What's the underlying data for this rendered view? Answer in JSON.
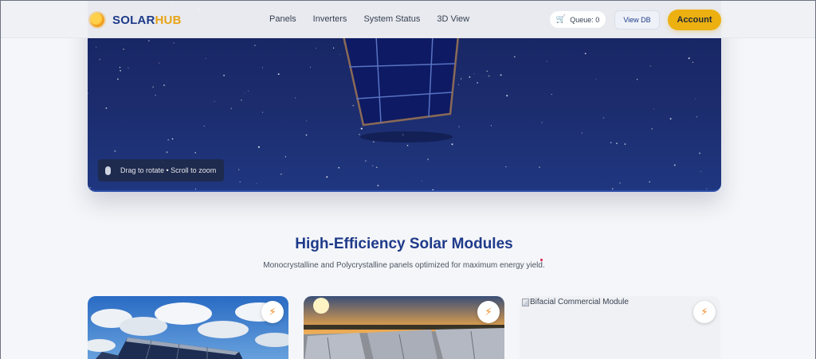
{
  "brand": {
    "name_part1": "SOLAR",
    "name_part2": "HUB",
    "logo_icon": "sun-icon"
  },
  "nav": {
    "links": [
      {
        "label": "Panels"
      },
      {
        "label": "Inverters"
      },
      {
        "label": "System Status"
      },
      {
        "label": "3D View"
      }
    ],
    "queue_label": "Queue: 0",
    "queue_icon": "cart-icon",
    "view_db_label": "View DB",
    "account_label": "Account"
  },
  "viewer": {
    "hint": "Drag to rotate • Scroll to zoom",
    "hint_icon": "mouse-icon"
  },
  "section": {
    "title": "High-Efficiency Solar Modules",
    "subtitle": "Monocrystalline and Polycrystalline panels optimized for maximum energy yield."
  },
  "cards": [
    {
      "image": "solar-field-cloudy-sky",
      "badge_icon": "bolt-icon"
    },
    {
      "image": "rooftop-panels-sunset",
      "badge_icon": "bolt-icon"
    },
    {
      "image_alt": "Bifacial Commercial Module",
      "badge_icon": "bolt-icon"
    }
  ],
  "colors": {
    "brand_blue": "#1e3a8a",
    "brand_gold": "#e8a317",
    "account_button": "#ecb011",
    "bolt": "#f08a24",
    "hero_bg": "#1c2c6d"
  }
}
